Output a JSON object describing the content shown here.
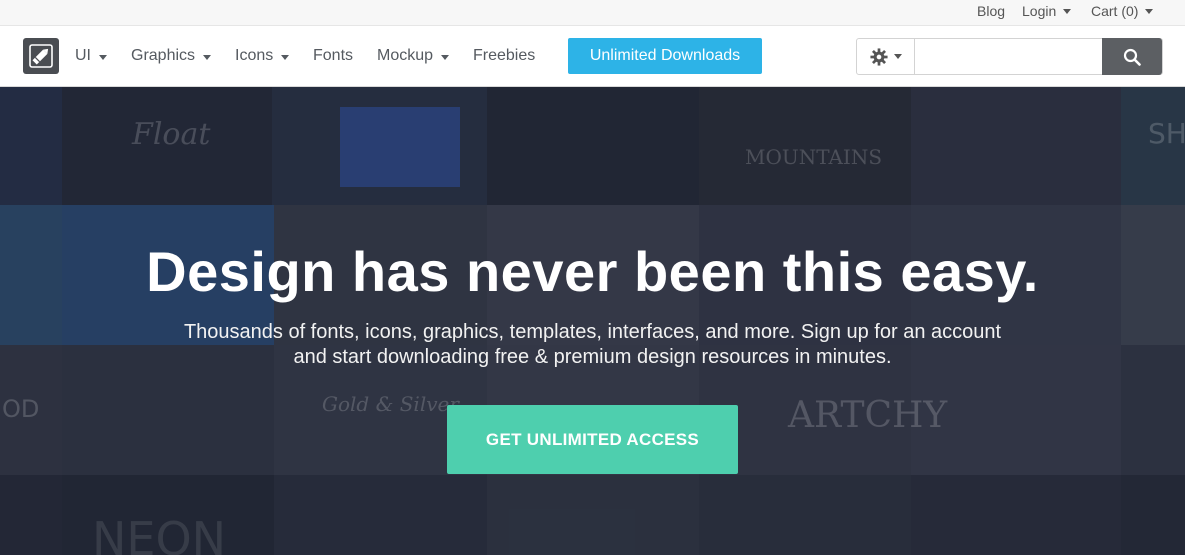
{
  "topbar": {
    "blog": "Blog",
    "login": "Login",
    "cart": "Cart (0)"
  },
  "nav": {
    "items": [
      {
        "label": "UI",
        "dropdown": true
      },
      {
        "label": "Graphics",
        "dropdown": true
      },
      {
        "label": "Icons",
        "dropdown": true
      },
      {
        "label": "Fonts",
        "dropdown": false
      },
      {
        "label": "Mockup",
        "dropdown": true
      },
      {
        "label": "Freebies",
        "dropdown": false
      }
    ],
    "cta": "Unlimited Downloads",
    "search": {
      "placeholder": "",
      "value": ""
    },
    "icons": {
      "logo": "pencil-icon",
      "settings": "gear-icon",
      "search": "search-icon"
    }
  },
  "hero": {
    "title": "Design has never been this easy.",
    "subtitle_line1": "Thousands of fonts, icons, graphics, templates, interfaces, and more. Sign up for an account",
    "subtitle_line2": "and start downloading free & premium design resources in minutes.",
    "cta": "GET UNLIMITED ACCESS",
    "background_words": [
      "Float",
      "MOUNTAINS",
      "SH",
      "OD",
      "Gold & Silver",
      "ARTCHY",
      "NEON"
    ]
  },
  "colors": {
    "accent_blue": "#2db3e7",
    "accent_green": "#4ecfae",
    "hero_bg": "#222836"
  }
}
